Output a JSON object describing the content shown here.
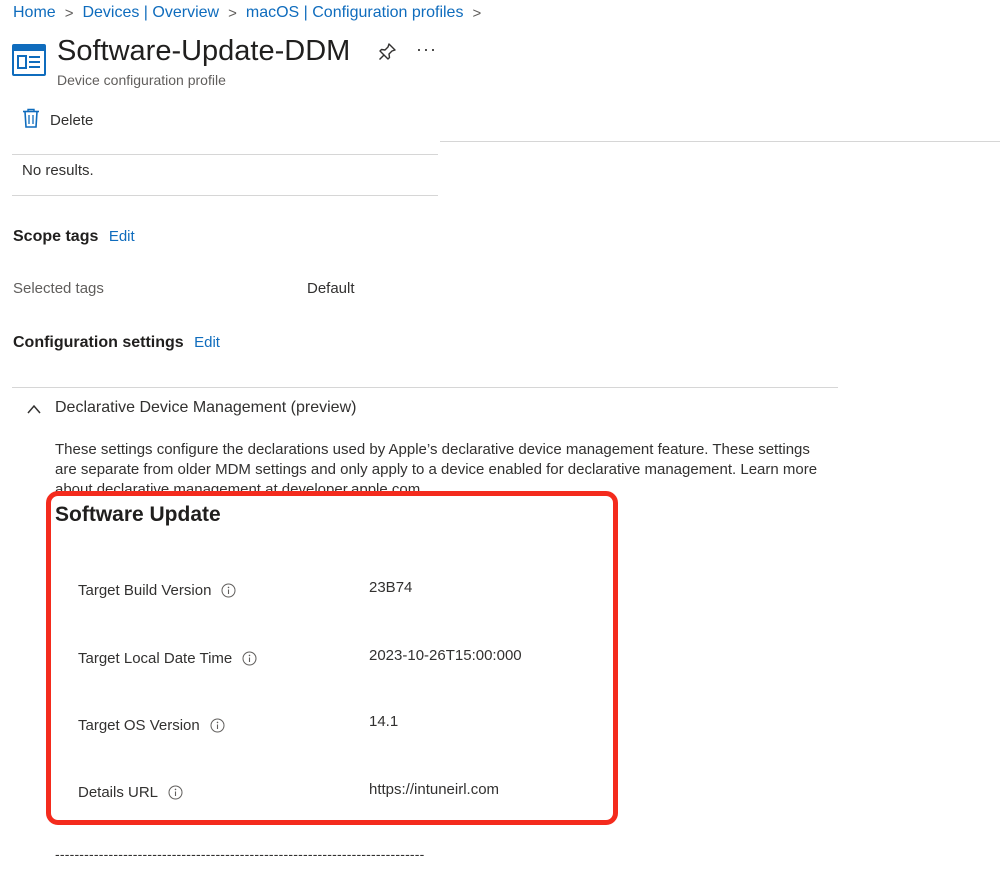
{
  "breadcrumb": {
    "items": [
      "Home",
      "Devices | Overview",
      "macOS | Configuration profiles"
    ],
    "separator": ">"
  },
  "header": {
    "title": "Software-Update-DDM",
    "subtitle": "Device configuration profile",
    "more_label": "···"
  },
  "toolbar": {
    "delete_label": "Delete"
  },
  "assignments_table": {
    "empty_text": "No results."
  },
  "scope_tags": {
    "heading": "Scope tags",
    "edit_label": "Edit",
    "selected_label": "Selected tags",
    "selected_value": "Default"
  },
  "configuration": {
    "heading": "Configuration settings",
    "edit_label": "Edit",
    "group_title": "Declarative Device Management (preview)",
    "description": "These settings configure the declarations used by Apple’s declarative device management feature. These settings are separate from older MDM settings and only apply to a device enabled for declarative management. Learn more about declarative management at developer.apple.com",
    "software_update": {
      "title": "Software Update",
      "settings": [
        {
          "label": "Target Build Version",
          "value": "23B74"
        },
        {
          "label": "Target Local Date Time",
          "value": "2023-10-26T15:00:000"
        },
        {
          "label": "Target OS Version",
          "value": "14.1"
        },
        {
          "label": "Details URL",
          "value": "https://intuneirl.com"
        }
      ]
    },
    "separator_text": "----------------------------------------------------------------------------"
  },
  "colors": {
    "accent": "#0f6cbd",
    "highlight": "#f42b1d",
    "text": "#323130",
    "muted": "#605e5c"
  },
  "icons": [
    "profile-icon",
    "pin-icon",
    "trash-icon",
    "chevron-up-icon",
    "info-icon"
  ]
}
